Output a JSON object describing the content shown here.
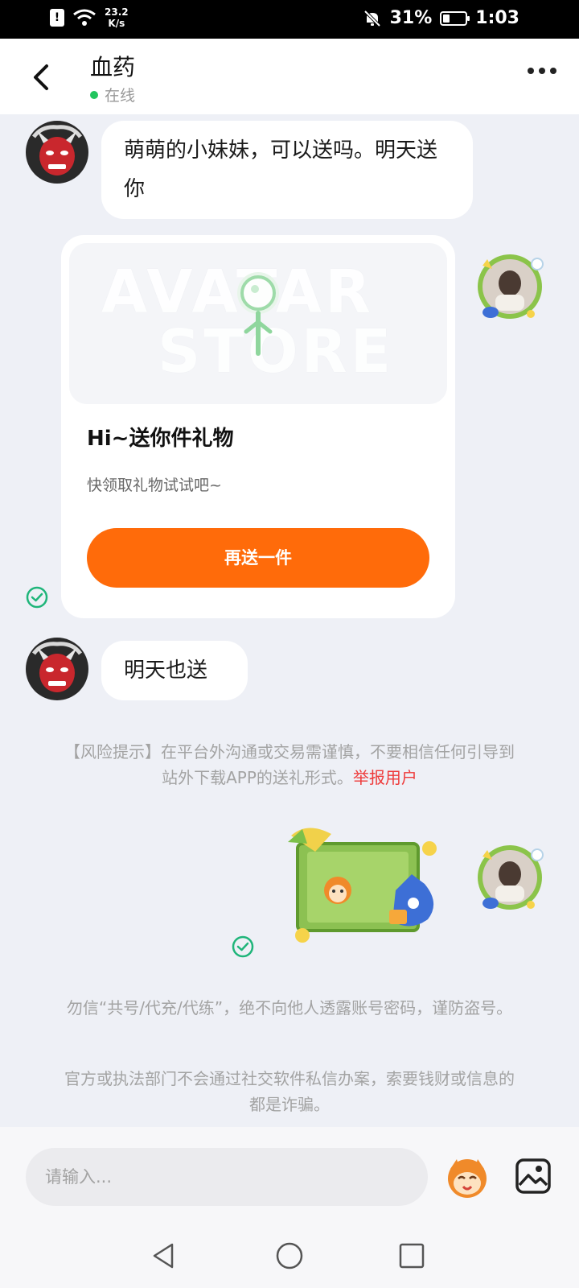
{
  "status_bar": {
    "network_speed_value": "23.2",
    "network_speed_unit": "K/s",
    "battery": "31%",
    "time": "1:03"
  },
  "header": {
    "title": "血药",
    "status": "在线"
  },
  "messages": {
    "incoming_1": "萌萌的小妹妹，可以送吗。明天送你",
    "gift_card": {
      "banner_line1": "AVATAR",
      "banner_line2": "STORE",
      "title": "Hi~送你件礼物",
      "subtitle": "快领取礼物试试吧~",
      "button": "再送一件"
    },
    "incoming_2": "明天也送"
  },
  "risk_notice": {
    "text": "【风险提示】在平台外沟通或交易需谨慎，不要相信任何引导到站外下载APP的送礼形式。",
    "report_link": "举报用户"
  },
  "notices": [
    "勿信“共号/代充/代练”，绝不向他人透露账号密码，谨防盗号。",
    "官方或执法部门不会通过社交软件私信办案，索要钱财或信息的都是诈骗。"
  ],
  "input": {
    "placeholder": "请输入..."
  },
  "colors": {
    "accent_orange": "#ff6b0a",
    "online_green": "#22c55e",
    "check_green": "#1fb57a",
    "report_red": "#ee3a3a",
    "background": "#eef0f6"
  },
  "icons": [
    "back-icon",
    "more-icon",
    "wifi-icon",
    "mute-bell-icon",
    "battery-icon",
    "check-circle-icon",
    "emoji-icon",
    "image-icon",
    "nav-back-icon",
    "nav-home-icon",
    "nav-recents-icon"
  ]
}
